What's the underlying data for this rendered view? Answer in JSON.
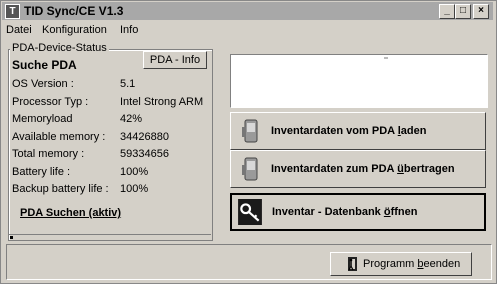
{
  "window": {
    "title": "TID Sync/CE V1.3"
  },
  "menu": {
    "items": [
      "Datei",
      "Konfiguration",
      "Info"
    ]
  },
  "status_group": {
    "label": "PDA-Device-Status",
    "heading": "Suche PDA",
    "info_button": "PDA - Info",
    "rows": [
      {
        "label": "OS Version :",
        "value": "5.1"
      },
      {
        "label": "Processor Typ :",
        "value": "Intel Strong ARM"
      },
      {
        "label": "Memoryload",
        "value": "42%"
      },
      {
        "label": "Available memory :",
        "value": "34426880"
      },
      {
        "label": "Total memory :",
        "value": "59334656"
      },
      {
        "label": "Battery life :",
        "value": "100%"
      },
      {
        "label": "Backup battery life :",
        "value": "100%"
      }
    ],
    "search_link": "PDA Suchen (aktiv)"
  },
  "actions": {
    "load": {
      "pre": "Inventardaten vom PDA ",
      "u": "l",
      "post": "aden"
    },
    "transfer": {
      "pre": "Inventardaten zum PDA ",
      "u": "ü",
      "post": "bertragen"
    },
    "db": {
      "pre": "Inventar - Datenbank ",
      "u": "ö",
      "post": "ffnen"
    }
  },
  "exit_button": {
    "pre": "Programm ",
    "u": "b",
    "post": "eenden"
  }
}
